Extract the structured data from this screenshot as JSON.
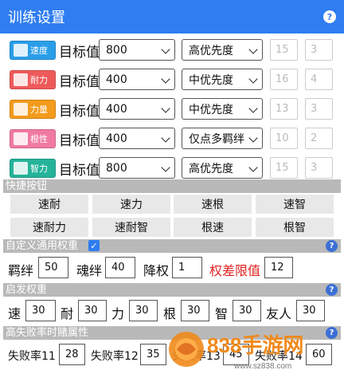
{
  "window": {
    "title": "训练设置"
  },
  "targets": {
    "label": "目标值",
    "rows": [
      {
        "badge": "速度",
        "color": "#2a9ee8",
        "value": "800",
        "priority": "高优先度",
        "slot1": "15",
        "slot2": "3"
      },
      {
        "badge": "耐力",
        "color": "#ee5a5a",
        "value": "400",
        "priority": "中优先度",
        "slot1": "16",
        "slot2": "4"
      },
      {
        "badge": "力量",
        "color": "#f39b1c",
        "value": "400",
        "priority": "中优先度",
        "slot1": "13",
        "slot2": "3"
      },
      {
        "badge": "根性",
        "color": "#f07aa3",
        "value": "400",
        "priority": "仅点多羁绊",
        "slot1": "10",
        "slot2": "2"
      },
      {
        "badge": "智力",
        "color": "#25b39a",
        "value": "800",
        "priority": "高优先度",
        "slot1": "15",
        "slot2": "3"
      }
    ]
  },
  "quick": {
    "title": "快捷按钮",
    "buttons": [
      "速耐",
      "速力",
      "速根",
      "速智",
      "速耐力",
      "速耐智",
      "根速",
      "根智"
    ]
  },
  "custom_weight": {
    "title": "自定义通用权重",
    "checked": true,
    "fields": [
      {
        "label": "羁绊",
        "value": "50"
      },
      {
        "label": "魂绊",
        "value": "40"
      },
      {
        "label": "降权",
        "value": "1"
      },
      {
        "label": "权差限值",
        "value": "12"
      }
    ]
  },
  "enlighten": {
    "title": "启发权重",
    "fields": [
      {
        "label": "速",
        "value": "30"
      },
      {
        "label": "耐",
        "value": "30"
      },
      {
        "label": "力",
        "value": "30"
      },
      {
        "label": "根",
        "value": "30"
      },
      {
        "label": "智",
        "value": "30"
      },
      {
        "label": "友人",
        "value": "30"
      }
    ]
  },
  "gamble": {
    "title": "高失败率时赌属性",
    "fields": [
      {
        "label": "失败率11",
        "value": "28"
      },
      {
        "label": "失败率12",
        "value": "35"
      },
      {
        "label": "失败率13",
        "value": "45"
      },
      {
        "label": "失败率14",
        "value": "60"
      }
    ]
  },
  "watermark": {
    "brand": "838手游网",
    "url": "www.sz838.com"
  },
  "help_glyph": "?"
}
